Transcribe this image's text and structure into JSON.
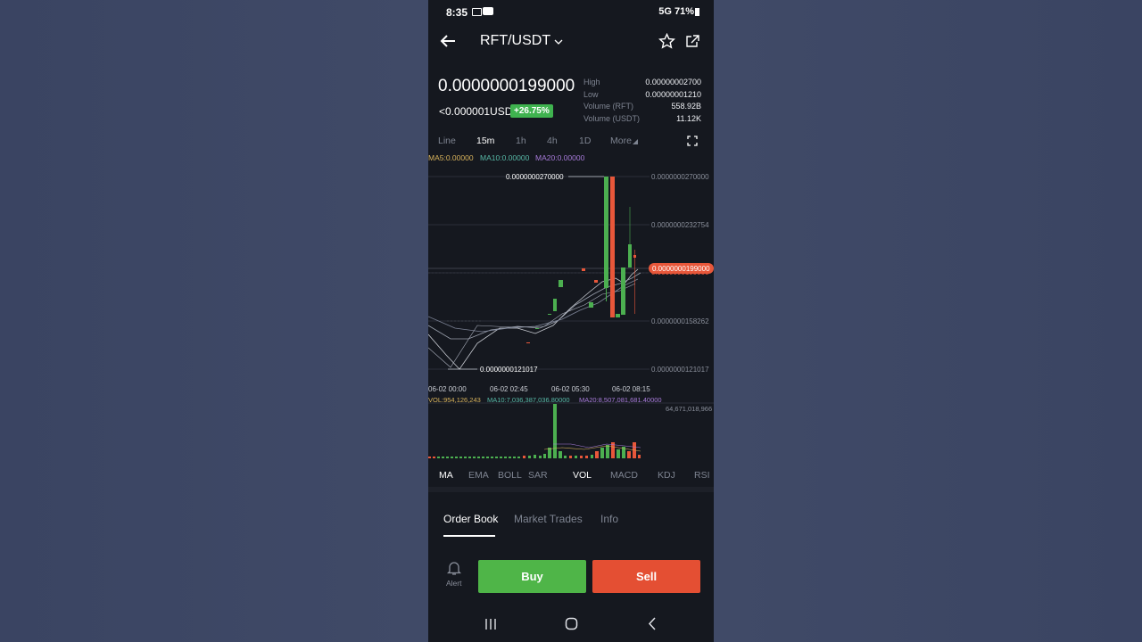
{
  "status": {
    "time": "8:35",
    "right": "5G  71%"
  },
  "header": {
    "pair": "RFT/USDT"
  },
  "ticker": {
    "price": "0.0000000199000",
    "usd": "<0.000001USD",
    "change": "+26.75%",
    "stats": [
      {
        "label": "High",
        "value": "0.00000002700"
      },
      {
        "label": "Low",
        "value": "0.00000001210"
      },
      {
        "label": "Volume (RFT)",
        "value": "558.92B"
      },
      {
        "label": "Volume (USDT)",
        "value": "11.12K"
      }
    ]
  },
  "timeframes": [
    "Line",
    "15m",
    "1h",
    "4h",
    "1D",
    "More"
  ],
  "ma": {
    "ma5": "MA5:0.00000",
    "ma10": "MA10:0.00000",
    "ma20": "MA20:0.00000"
  },
  "chart_labels": {
    "high_marker": "0.0000000270000",
    "low_marker": "0.0000000121017",
    "current": "0.0000000199000",
    "current_behind": "0.0000000199000",
    "y_ticks": [
      "0.0000000270000",
      "0.0000000232754",
      "0.0000000158262",
      "0.0000000121017"
    ],
    "x_ticks": [
      "06-02 00:00",
      "06-02 02:45",
      "06-02 05:30",
      "06-02 08:15"
    ],
    "vol_line": "VOL:954,126,243",
    "vol_ma10": "MA10:7,036,387,036.80000",
    "vol_ma20": "MA20:8,507,081,681.40000",
    "vol_max": "64,671,018,966"
  },
  "colors": {
    "up": "#4caf50",
    "down": "#e8573a",
    "bg": "#15181f"
  },
  "chart_data": {
    "type": "candlestick",
    "y_axis_ticks": [
      2.7e-08,
      2.32754e-08,
      1.58262e-08,
      1.21017e-08
    ],
    "ylim": [
      1.21017e-08,
      2.7e-08
    ],
    "x_ticks": [
      "06-02 00:00",
      "06-02 02:45",
      "06-02 05:30",
      "06-02 08:15"
    ],
    "current_price": 1.99e-08,
    "volume_max": 64671018966
  },
  "indicators": [
    "MA",
    "EMA",
    "BOLL",
    "SAR",
    "VOL",
    "MACD",
    "KDJ",
    "RSI"
  ],
  "tabs": [
    "Order Book",
    "Market Trades",
    "Info"
  ],
  "bottom": {
    "alert": "Alert",
    "buy": "Buy",
    "sell": "Sell"
  }
}
